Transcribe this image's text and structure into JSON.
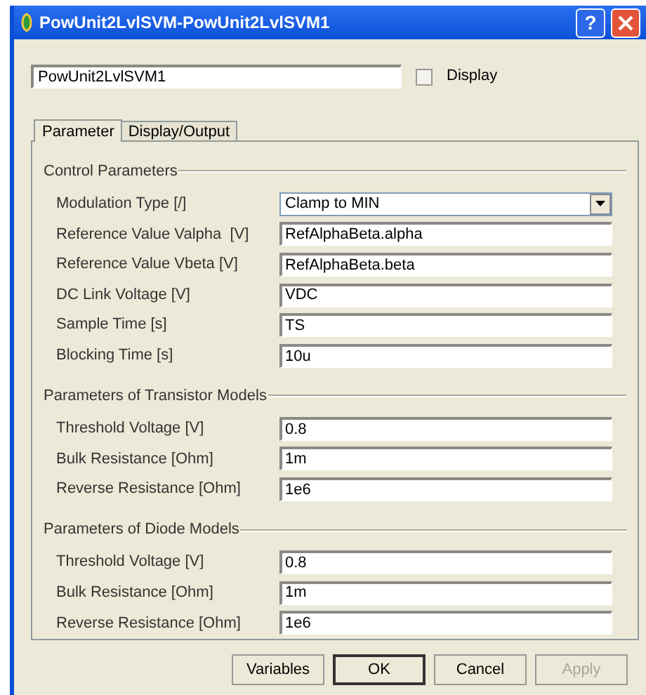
{
  "window": {
    "title": "PowUnit2LvlSVM-PowUnit2LvlSVM1",
    "help_button": "?"
  },
  "name_field": {
    "value": "PowUnit2LvlSVM1"
  },
  "display_checkbox": {
    "label": "Display",
    "checked": false
  },
  "tabs": [
    {
      "label": "Parameter",
      "selected": true
    },
    {
      "label": "Display/Output",
      "selected": false
    }
  ],
  "sections": [
    {
      "title": "Control Parameters",
      "rows": [
        {
          "kind": "dropdown",
          "label": "Modulation Type [/]",
          "value": "Clamp to MIN"
        },
        {
          "kind": "text",
          "label": "Reference Value Valpha  [V]",
          "value": "RefAlphaBeta.alpha"
        },
        {
          "kind": "text",
          "label": "Reference Value Vbeta [V]",
          "value": "RefAlphaBeta.beta"
        },
        {
          "kind": "text",
          "label": "DC Link Voltage [V]",
          "value": "VDC"
        },
        {
          "kind": "text",
          "label": "Sample Time [s]",
          "value": "TS"
        },
        {
          "kind": "text",
          "label": "Blocking Time [s]",
          "value": "10u"
        }
      ]
    },
    {
      "title": "Parameters of Transistor Models",
      "rows": [
        {
          "kind": "text",
          "label": "Threshold Voltage [V]",
          "value": "0.8"
        },
        {
          "kind": "text",
          "label": "Bulk Resistance [Ohm]",
          "value": "1m"
        },
        {
          "kind": "text",
          "label": "Reverse Resistance [Ohm]",
          "value": "1e6"
        }
      ]
    },
    {
      "title": "Parameters of Diode Models",
      "rows": [
        {
          "kind": "text",
          "label": "Threshold Voltage [V]",
          "value": "0.8"
        },
        {
          "kind": "text",
          "label": "Bulk Resistance [Ohm]",
          "value": "1m"
        },
        {
          "kind": "text",
          "label": "Reverse Resistance [Ohm]",
          "value": "1e6"
        }
      ]
    }
  ],
  "buttons": [
    {
      "label": "Variables",
      "default": false,
      "disabled": false
    },
    {
      "label": "OK",
      "default": true,
      "disabled": false
    },
    {
      "label": "Cancel",
      "default": false,
      "disabled": false
    },
    {
      "label": "Apply",
      "default": false,
      "disabled": true
    }
  ]
}
